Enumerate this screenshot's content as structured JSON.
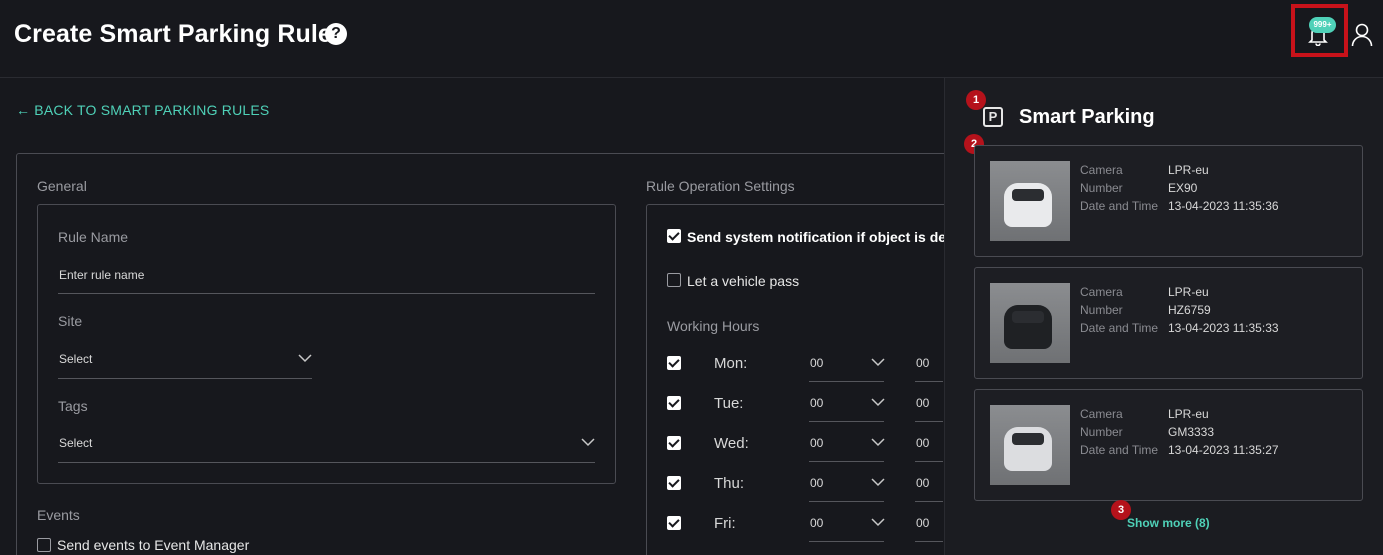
{
  "header": {
    "title": "Create Smart Parking Rule",
    "help_glyph": "?",
    "badge_count": "999+"
  },
  "back_link": "← BACK TO SMART PARKING RULES",
  "general": {
    "section": "General",
    "rule_name_label": "Rule Name",
    "rule_name_placeholder": "Enter rule name",
    "site_label": "Site",
    "site_value": "Select",
    "tags_label": "Tags",
    "tags_value": "Select"
  },
  "events": {
    "section": "Events",
    "send_events_label": "Send events to Event Manager"
  },
  "operation": {
    "section": "Rule Operation Settings",
    "notify_label": "Send system notification if object is de",
    "pass_label": "Let a vehicle pass",
    "working_hours_label": "Working Hours",
    "days": [
      {
        "name": "Mon:",
        "from": "00",
        "to": "00"
      },
      {
        "name": "Tue:",
        "from": "00",
        "to": "00"
      },
      {
        "name": "Wed:",
        "from": "00",
        "to": "00"
      },
      {
        "name": "Thu:",
        "from": "00",
        "to": "00"
      },
      {
        "name": "Fri:",
        "from": "00",
        "to": "00"
      }
    ]
  },
  "side_panel": {
    "icon_letter": "P",
    "title": "Smart Parking",
    "markers": [
      "1",
      "2",
      "3"
    ],
    "field_labels": {
      "camera": "Camera",
      "number": "Number",
      "datetime": "Date and Time"
    },
    "cards": [
      {
        "camera": "LPR-eu",
        "number": "EX90",
        "datetime": "13-04-2023 11:35:36",
        "car_color": "#e9eaec"
      },
      {
        "camera": "LPR-eu",
        "number": "HZ6759",
        "datetime": "13-04-2023 11:35:33",
        "car_color": "#1f2124"
      },
      {
        "camera": "LPR-eu",
        "number": "GM3333",
        "datetime": "13-04-2023 11:35:27",
        "car_color": "#dcdde0"
      }
    ],
    "show_more": "Show more (8)"
  },
  "colors": {
    "accent": "#4fd1b8",
    "marker": "#b5121b",
    "highlight": "#c8121a"
  }
}
